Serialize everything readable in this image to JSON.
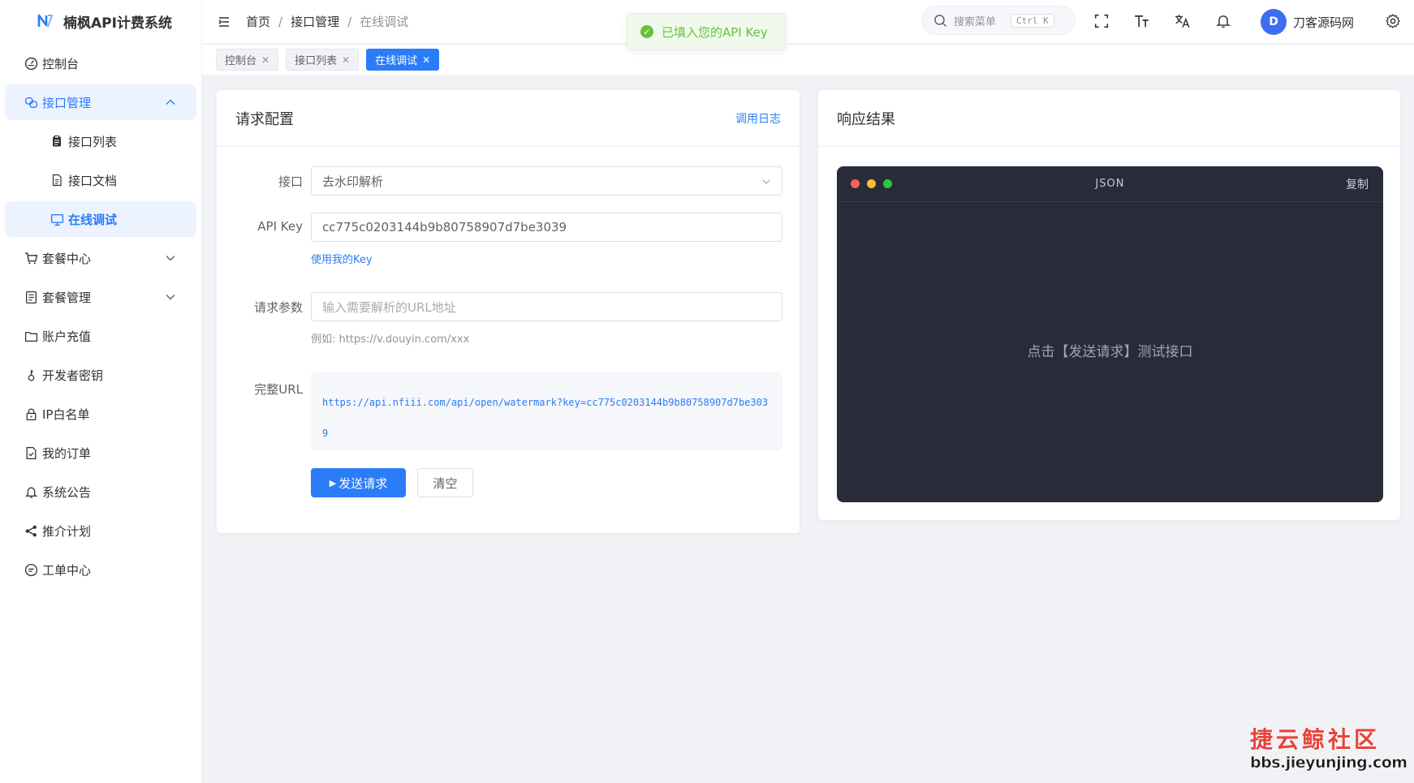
{
  "app": {
    "title": "楠枫API计费系统"
  },
  "sidebar": {
    "items": [
      {
        "label": "控制台",
        "icon": "dashboard-icon"
      },
      {
        "label": "接口管理",
        "icon": "api-icon",
        "expanded": true
      },
      {
        "label": "接口列表",
        "icon": "clipboard-icon"
      },
      {
        "label": "接口文档",
        "icon": "document-icon"
      },
      {
        "label": "在线调试",
        "icon": "monitor-icon",
        "active": true
      },
      {
        "label": "套餐中心",
        "icon": "cart-icon"
      },
      {
        "label": "套餐管理",
        "icon": "list-icon"
      },
      {
        "label": "账户充值",
        "icon": "wallet-icon"
      },
      {
        "label": "开发者密钥",
        "icon": "key-icon"
      },
      {
        "label": "IP白名单",
        "icon": "lock-icon"
      },
      {
        "label": "我的订单",
        "icon": "order-icon"
      },
      {
        "label": "系统公告",
        "icon": "bell-icon"
      },
      {
        "label": "推介计划",
        "icon": "share-icon"
      },
      {
        "label": "工单中心",
        "icon": "chat-icon"
      }
    ]
  },
  "header": {
    "breadcrumb": [
      "首页",
      "接口管理",
      "在线调试"
    ],
    "search_placeholder": "搜索菜单",
    "search_shortcut": "Ctrl K",
    "user_initial": "D",
    "user_name": "刀客源码网"
  },
  "tags": [
    {
      "label": "控制台",
      "active": false
    },
    {
      "label": "接口列表",
      "active": false
    },
    {
      "label": "在线调试",
      "active": true
    }
  ],
  "toast": {
    "message": "已填入您的API Key",
    "color": "#67c23a"
  },
  "request_card": {
    "title": "请求配置",
    "log_link": "调用日志",
    "api_label": "接口",
    "api_value": "去水印解析",
    "key_label": "API Key",
    "key_value": "cc775c0203144b9b80758907d7be3039",
    "use_key_link": "使用我的Key",
    "params_label": "请求参数",
    "params_placeholder": "输入需要解析的URL地址",
    "params_example": "例如: https://v.douyin.com/xxx",
    "url_label": "完整URL",
    "full_url": "https://api.nfiii.com/api/open/watermark?key=cc775c0203144b9b80758907d7be3039",
    "send_button": "发送请求",
    "clear_button": "清空"
  },
  "response_card": {
    "title": "响应结果",
    "terminal_title": "JSON",
    "copy_label": "复制",
    "empty_text": "点击【发送请求】测试接口"
  },
  "watermark": {
    "line1": "捷云鲸社区",
    "line2": "bbs.jieyunjing.com"
  },
  "colors": {
    "primary": "#2a7cf8",
    "terminal_bg": "#282c38",
    "success": "#67c23a"
  }
}
